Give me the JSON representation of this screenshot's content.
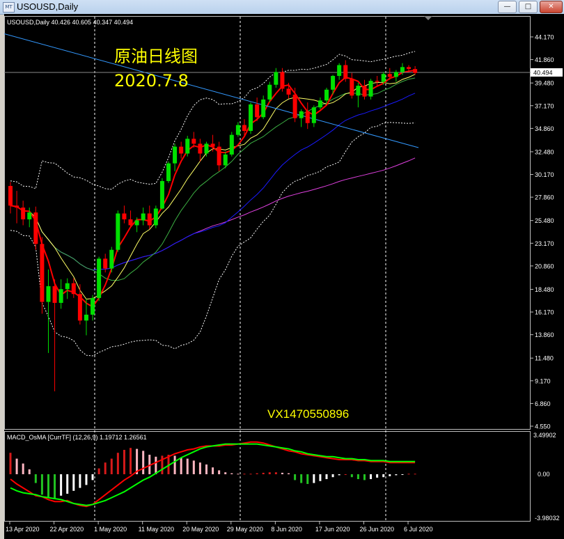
{
  "window": {
    "title": "USOUSD,Daily",
    "icon": "chart-window-icon",
    "buttons": {
      "minimize": "—",
      "maximize": "□",
      "close": "✕"
    }
  },
  "main": {
    "ohlc_label": "USOUSD,Daily  40.426 40.605 40.347 40.494",
    "annotation_title": "原油日线图",
    "annotation_date": "2020.7.8",
    "watermark": "VX1470550896",
    "current_price": "40.494"
  },
  "macd": {
    "label": "MACD_OsMA [CurrTF] (12,26,9) 1.19712 1.26561",
    "axis": [
      "3.49902",
      "0.00",
      "-3.98032"
    ]
  },
  "colors": {
    "bull": "#00e000",
    "bear": "#ff0000",
    "ma_red": "#ff0000",
    "ma_yellow": "#ffff66",
    "ma_green": "#3cb043",
    "ma_blue": "#1a1aff",
    "ma_magenta": "#e040e0",
    "trendline": "#3399ff",
    "bands": "#ffffff",
    "macd_pos_high": "#d61a1a",
    "macd_pos_low": "#ffb6c1",
    "macd_neg_high": "#22c422",
    "macd_neg_low": "#ffffff",
    "signal": "#00ff00",
    "macd_line": "#ff0000"
  },
  "chart_data": {
    "type": "candlestick",
    "symbol": "USOUSD",
    "timeframe": "Daily",
    "x_tick_labels": [
      "13 Apr 2020",
      "22 Apr 2020",
      "1 May 2020",
      "11 May 2020",
      "20 May 2020",
      "29 May 2020",
      "8 Jun 2020",
      "17 Jun 2020",
      "26 Jun 2020",
      "6 Jul 2020"
    ],
    "y_tick_labels": [
      "44.170",
      "41.860",
      "39.480",
      "37.170",
      "34.860",
      "32.480",
      "30.170",
      "27.860",
      "25.480",
      "23.170",
      "20.860",
      "18.480",
      "16.170",
      "13.860",
      "11.480",
      "9.170",
      "6.860",
      "4.550"
    ],
    "ylim": [
      4.55,
      44.17
    ],
    "candles": [
      [
        29.0,
        29.4,
        26.2,
        27.0
      ],
      [
        27.0,
        28.5,
        25.2,
        26.8
      ],
      [
        26.8,
        27.5,
        25.0,
        25.6
      ],
      [
        25.6,
        26.8,
        24.8,
        26.3
      ],
      [
        26.3,
        26.9,
        22.5,
        23.1
      ],
      [
        23.1,
        23.8,
        16.0,
        17.2
      ],
      [
        17.2,
        20.5,
        12.0,
        18.8
      ],
      [
        18.8,
        19.5,
        8.1,
        17.1
      ],
      [
        17.1,
        19.5,
        16.5,
        18.5
      ],
      [
        18.5,
        19.6,
        17.5,
        19.1
      ],
      [
        19.1,
        19.6,
        17.6,
        18.0
      ],
      [
        18.0,
        19.0,
        14.9,
        15.3
      ],
      [
        15.3,
        17.5,
        13.8,
        15.9
      ],
      [
        15.9,
        17.9,
        15.3,
        17.6
      ],
      [
        17.6,
        21.8,
        17.3,
        21.6
      ],
      [
        21.6,
        22.1,
        20.2,
        20.6
      ],
      [
        20.6,
        22.8,
        20.2,
        22.5
      ],
      [
        22.5,
        26.5,
        22.3,
        26.2
      ],
      [
        26.2,
        27.0,
        25.2,
        25.6
      ],
      [
        25.6,
        26.5,
        24.8,
        25.0
      ],
      [
        25.0,
        25.8,
        24.3,
        25.5
      ],
      [
        25.5,
        26.8,
        25.0,
        26.2
      ],
      [
        26.2,
        27.0,
        24.6,
        25.0
      ],
      [
        25.0,
        27.0,
        24.7,
        26.7
      ],
      [
        26.7,
        29.8,
        26.6,
        29.5
      ],
      [
        29.5,
        31.5,
        29.3,
        31.3
      ],
      [
        31.3,
        33.3,
        30.5,
        33.0
      ],
      [
        33.0,
        33.5,
        31.8,
        32.3
      ],
      [
        32.3,
        34.1,
        32.0,
        33.8
      ],
      [
        33.8,
        34.5,
        32.9,
        33.3
      ],
      [
        33.3,
        33.8,
        31.5,
        32.3
      ],
      [
        32.3,
        33.5,
        32.0,
        33.3
      ],
      [
        33.3,
        34.2,
        32.5,
        33.0
      ],
      [
        33.0,
        33.5,
        30.5,
        31.1
      ],
      [
        31.1,
        32.5,
        30.8,
        32.2
      ],
      [
        32.2,
        34.5,
        32.0,
        34.2
      ],
      [
        34.2,
        35.5,
        34.0,
        35.2
      ],
      [
        35.2,
        35.8,
        34.0,
        34.6
      ],
      [
        34.6,
        37.5,
        34.3,
        37.3
      ],
      [
        37.3,
        38.0,
        35.6,
        36.0
      ],
      [
        36.0,
        38.2,
        35.8,
        37.8
      ],
      [
        37.8,
        39.6,
        37.5,
        39.3
      ],
      [
        39.3,
        41.0,
        39.0,
        40.6
      ],
      [
        40.6,
        41.0,
        38.6,
        38.9
      ],
      [
        38.9,
        39.5,
        37.9,
        38.3
      ],
      [
        38.3,
        39.0,
        35.5,
        35.9
      ],
      [
        35.9,
        36.8,
        35.0,
        36.6
      ],
      [
        36.6,
        37.5,
        34.8,
        35.4
      ],
      [
        35.4,
        37.2,
        35.0,
        37.0
      ],
      [
        37.0,
        38.0,
        36.8,
        37.7
      ],
      [
        37.7,
        39.0,
        37.4,
        38.8
      ],
      [
        38.8,
        40.3,
        38.3,
        40.2
      ],
      [
        40.2,
        41.5,
        39.8,
        41.3
      ],
      [
        41.3,
        41.8,
        39.6,
        39.9
      ],
      [
        39.9,
        40.5,
        37.9,
        38.2
      ],
      [
        38.2,
        39.5,
        37.0,
        39.2
      ],
      [
        39.2,
        39.8,
        37.8,
        38.1
      ],
      [
        38.1,
        39.9,
        37.8,
        39.7
      ],
      [
        39.7,
        40.2,
        39.2,
        39.6
      ],
      [
        39.6,
        40.6,
        39.3,
        40.4
      ],
      [
        40.4,
        41.0,
        39.8,
        40.1
      ],
      [
        40.1,
        40.8,
        39.6,
        40.6
      ],
      [
        40.6,
        41.5,
        40.3,
        41.1
      ],
      [
        41.1,
        41.3,
        40.6,
        40.9
      ],
      [
        40.9,
        41.2,
        40.3,
        40.5
      ]
    ],
    "macd": {
      "histogram": [
        2.2,
        1.6,
        1.1,
        0.5,
        -0.9,
        -2.1,
        -2.4,
        -2.5,
        -2.2,
        -2.0,
        -1.7,
        -1.4,
        -1.1,
        -0.6,
        0.6,
        1.2,
        1.6,
        2.2,
        2.5,
        2.7,
        2.6,
        2.4,
        2.0,
        1.8,
        1.9,
        2.0,
        1.9,
        1.7,
        1.6,
        1.4,
        1.2,
        1.0,
        0.7,
        0.4,
        0.2,
        0.1,
        0.05,
        0.05,
        0.05,
        0.1,
        0.15,
        0.2,
        0.2,
        0.15,
        0.1,
        -0.6,
        -0.9,
        -1.0,
        -0.9,
        -0.7,
        -0.5,
        -0.3,
        -0.1,
        0.0,
        -0.3,
        -0.5,
        -0.6,
        -0.5,
        -0.35,
        -0.3,
        -0.2,
        -0.1,
        -0.05,
        0.05,
        0.05
      ],
      "macd_line": [
        -0.5,
        -1.0,
        -1.4,
        -1.8,
        -2.2,
        -2.3,
        -2.6,
        -2.8,
        -2.8,
        -2.7,
        -3.0,
        -3.2,
        -3.3,
        -3.1,
        -2.6,
        -2.1,
        -1.6,
        -1.1,
        -0.6,
        -0.2,
        0.3,
        0.6,
        0.9,
        1.2,
        1.5,
        1.8,
        2.1,
        2.3,
        2.5,
        2.6,
        2.8,
        2.9,
        2.9,
        2.9,
        3.0,
        3.0,
        3.1,
        3.2,
        3.3,
        3.3,
        3.2,
        3.0,
        2.8,
        2.6,
        2.4,
        2.3,
        2.1,
        2.0,
        1.9,
        1.8,
        1.7,
        1.6,
        1.5,
        1.5,
        1.5,
        1.4,
        1.4,
        1.3,
        1.3,
        1.3,
        1.2,
        1.2,
        1.2,
        1.2,
        1.2
      ],
      "signal_line": [
        -1.4,
        -1.7,
        -1.9,
        -2.0,
        -2.1,
        -2.3,
        -2.4,
        -2.5,
        -2.6,
        -2.8,
        -3.0,
        -3.1,
        -3.2,
        -3.1,
        -2.9,
        -2.7,
        -2.4,
        -2.1,
        -1.8,
        -1.4,
        -1.0,
        -0.6,
        -0.3,
        0.1,
        0.5,
        0.9,
        1.3,
        1.7,
        2.0,
        2.3,
        2.6,
        2.8,
        2.9,
        3.0,
        3.1,
        3.1,
        3.1,
        3.1,
        3.1,
        3.1,
        3.0,
        2.9,
        2.8,
        2.7,
        2.6,
        2.4,
        2.3,
        2.1,
        2.0,
        1.9,
        1.8,
        1.8,
        1.7,
        1.6,
        1.6,
        1.5,
        1.5,
        1.4,
        1.4,
        1.4,
        1.3,
        1.3,
        1.3,
        1.3,
        1.3
      ]
    }
  }
}
